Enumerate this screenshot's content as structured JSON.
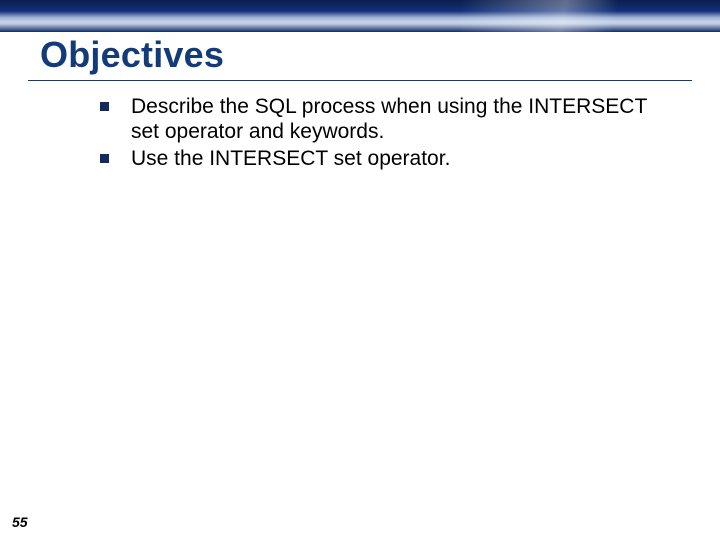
{
  "slide": {
    "title": "Objectives",
    "bullets": [
      "Describe the SQL process when using the INTERSECT set operator and keywords.",
      "Use the INTERSECT set operator."
    ],
    "page_number": "55"
  }
}
